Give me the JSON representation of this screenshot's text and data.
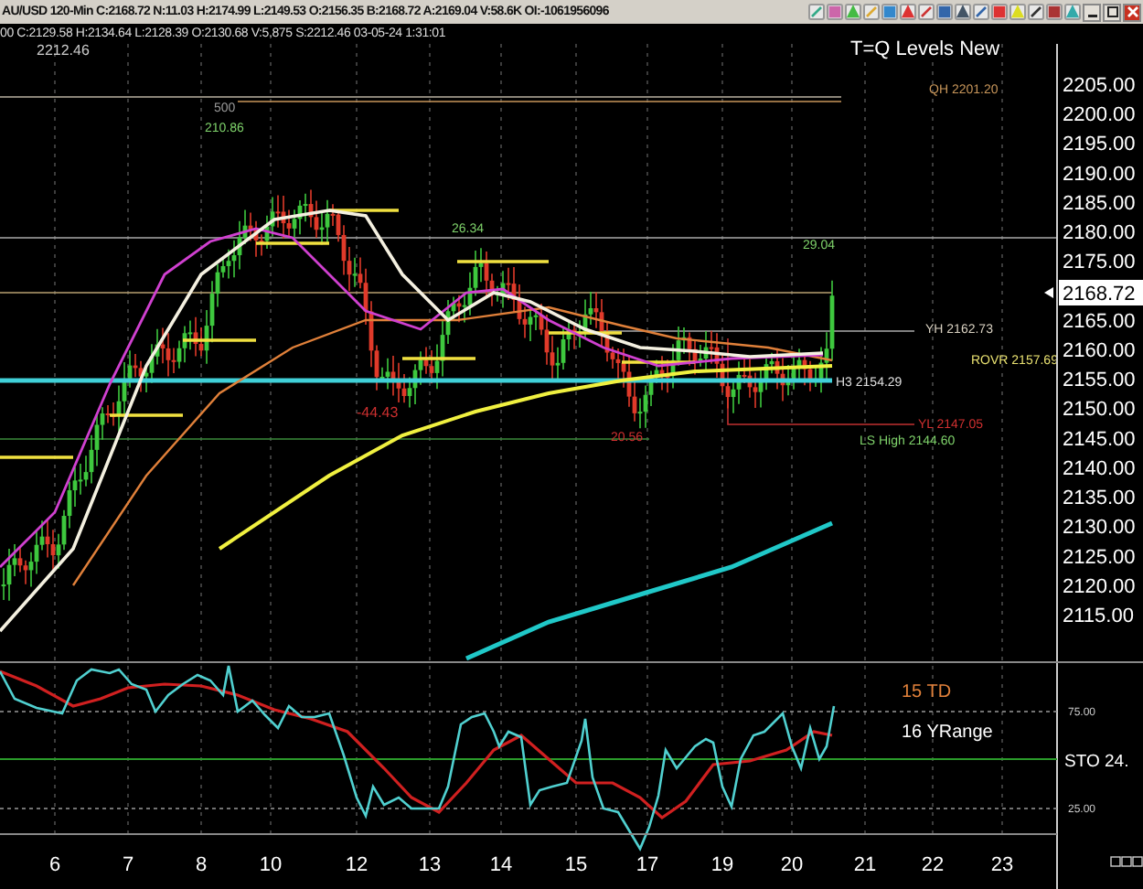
{
  "window": {
    "title": "AU/USD 120-Min C:2168.72 N:11.03 H:2174.99 L:2149.53 O:2156.35 B:2168.72 A:2169.04 V:58.6K OI:-1061956096"
  },
  "info_line": "00 C:2129.58 H:2134.64 L:2128.39 O:2130.68 V:5,875 S:2212.46 03-05-24 1:31:01",
  "price_chart": {
    "title": "T=Q Levels New",
    "high_label": "2212.46",
    "last_price": "2168.72",
    "labels": [
      {
        "text": "500",
        "color": "#9a9a9a"
      },
      {
        "text": "210.86",
        "color": "#7fd36b"
      },
      {
        "text": "QH 2201.20",
        "color": "#c8965a"
      },
      {
        "text": "26.34",
        "color": "#7fd36b"
      },
      {
        "text": "29.04",
        "color": "#7fd36b"
      },
      {
        "text": "YH 2162.73",
        "color": "#d8d0c0"
      },
      {
        "text": "ROVR 2157.69",
        "color": "#e8e070"
      },
      {
        "text": "H3 2154.29",
        "color": "#e0e0e0"
      },
      {
        "text": "YL 2147.05",
        "color": "#d03030"
      },
      {
        "text": "LS High 2144.60",
        "color": "#7fd36b"
      },
      {
        "text": "-44.43",
        "color": "#d03030"
      },
      {
        "text": "20.56",
        "color": "#d03030"
      }
    ],
    "price_axis": [
      "2205.00",
      "2200.00",
      "2195.00",
      "2190.00",
      "2185.00",
      "2180.00",
      "2175.00",
      "2165.00",
      "2160.00",
      "2155.00",
      "2150.00",
      "2145.00",
      "2140.00",
      "2135.00",
      "2130.00",
      "2125.00",
      "2120.00",
      "2115.00"
    ]
  },
  "oscillator": {
    "name": "STO 24.",
    "levels": [
      "75.00",
      "25.00"
    ],
    "legend": [
      {
        "text": "15 TD",
        "color": "#e0803a"
      },
      {
        "text": "16 YRange",
        "color": "#ffffff"
      }
    ]
  },
  "date_axis": [
    "6",
    "7",
    "8",
    "10",
    "12",
    "13",
    "14",
    "15",
    "17",
    "19",
    "20",
    "21",
    "22",
    "23"
  ]
}
